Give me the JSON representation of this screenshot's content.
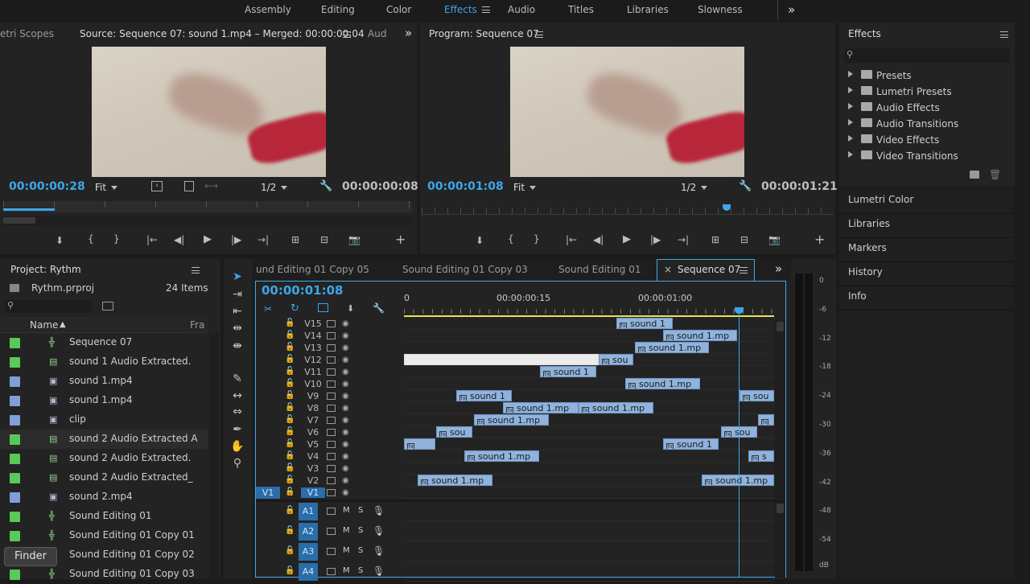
{
  "workspaces": {
    "items": [
      "Assembly",
      "Editing",
      "Color",
      "Effects",
      "Audio",
      "Titles",
      "Libraries",
      "Slowness"
    ],
    "active": "Effects",
    "more": "»"
  },
  "source": {
    "tab_left": "etri Scopes",
    "tab_title": "Source: Sequence 07: sound 1.mp4 – Merged: 00:00:00:04",
    "tab_right": "Aud",
    "more": "»",
    "timecode": "00:00:00:28",
    "fit": "Fit",
    "resolution": "1/2",
    "duration": "00:00:00:08",
    "playhead_fraction": 0.0
  },
  "program": {
    "tab_title": "Program: Sequence 07",
    "timecode": "00:00:01:08",
    "fit": "Fit",
    "resolution": "1/2",
    "duration": "00:00:01:21",
    "playhead_fraction": 0.74
  },
  "effects": {
    "title": "Effects",
    "items": [
      "Presets",
      "Lumetri Presets",
      "Audio Effects",
      "Audio Transitions",
      "Video Effects",
      "Video Transitions"
    ]
  },
  "side_panels": [
    "Lumetri Color",
    "Libraries",
    "Markers",
    "History",
    "Info"
  ],
  "project": {
    "title": "Project: Rythm",
    "file": "Rythm.prproj",
    "count": "24 Items",
    "col_name": "Name",
    "col_fr": "Fra",
    "items": [
      {
        "name": "Sequence 07",
        "color": "#5ac85a",
        "icon": "sequence-icon"
      },
      {
        "name": "sound 1 Audio Extracted.",
        "color": "#5ac85a",
        "icon": "audio-clip-icon"
      },
      {
        "name": "sound 1.mp4",
        "color": "#7f9fd6",
        "icon": "video-clip-icon"
      },
      {
        "name": "sound 1.mp4",
        "color": "#7f9fd6",
        "icon": "video-clip-icon"
      },
      {
        "name": "clip",
        "color": "#7f9fd6",
        "icon": "video-clip-icon"
      },
      {
        "name": "sound 2 Audio Extracted A",
        "color": "#5ac85a",
        "icon": "audio-clip-icon"
      },
      {
        "name": "sound 2 Audio Extracted.",
        "color": "#5ac85a",
        "icon": "audio-clip-icon"
      },
      {
        "name": "sound 2 Audio Extracted_",
        "color": "#5ac85a",
        "icon": "audio-clip-icon"
      },
      {
        "name": "sound 2.mp4",
        "color": "#7f9fd6",
        "icon": "video-clip-icon"
      },
      {
        "name": "Sound Editing 01",
        "color": "#5ac85a",
        "icon": "sequence-icon"
      },
      {
        "name": "Sound Editing 01 Copy 01",
        "color": "#5ac85a",
        "icon": "sequence-icon"
      },
      {
        "name": "Sound Editing 01 Copy 02",
        "color": "#5ac85a",
        "icon": "sequence-icon"
      },
      {
        "name": "Sound Editing 01 Copy 03",
        "color": "#5ac85a",
        "icon": "sequence-icon"
      }
    ],
    "tooltip": "Finder"
  },
  "timeline": {
    "tabs": [
      "und Editing 01 Copy 05",
      "Sound Editing 01 Copy 03",
      "Sound Editing 01",
      "Sequence 07"
    ],
    "active_tab": "Sequence 07",
    "more": "»",
    "timecode": "00:00:01:08",
    "ruler": [
      "0",
      "00:00:00:15",
      "00:00:01:00"
    ],
    "video_tracks": [
      "V15",
      "V14",
      "V13",
      "V12",
      "V11",
      "V10",
      "V9",
      "V8",
      "V7",
      "V6",
      "V5",
      "V4",
      "V3",
      "V2",
      "V1"
    ],
    "source_patch": "V1",
    "audio_tracks": [
      "A1",
      "A2",
      "A3",
      "A4"
    ],
    "audio_m": "M",
    "audio_s": "S",
    "clip_labels": {
      "V15": [
        "sound 1"
      ],
      "V14": [
        "sound 1.mp"
      ],
      "V13": [
        "sound 1.mp"
      ],
      "V12": [
        "",
        "sou"
      ],
      "V11": [
        "sound 1"
      ],
      "V10": [
        "sound 1.mp"
      ],
      "V9": [
        "sound 1",
        "sou"
      ],
      "V8": [
        "sound 1.mp",
        "sound 1.mp"
      ],
      "V7": [
        "sound 1.mp",
        ""
      ],
      "V6": [
        "sou",
        "sou"
      ],
      "V5": [
        "",
        "sound 1"
      ],
      "V4": [
        "sound 1.mp",
        "s"
      ],
      "V3": [],
      "V2": [
        "sound 1.mp",
        "sound 1.mp"
      ],
      "V1": []
    }
  },
  "meter": {
    "labels": [
      "0",
      "-6",
      "-12",
      "-18",
      "-24",
      "-30",
      "-36",
      "-42",
      "-48",
      "-54",
      "dB"
    ]
  }
}
